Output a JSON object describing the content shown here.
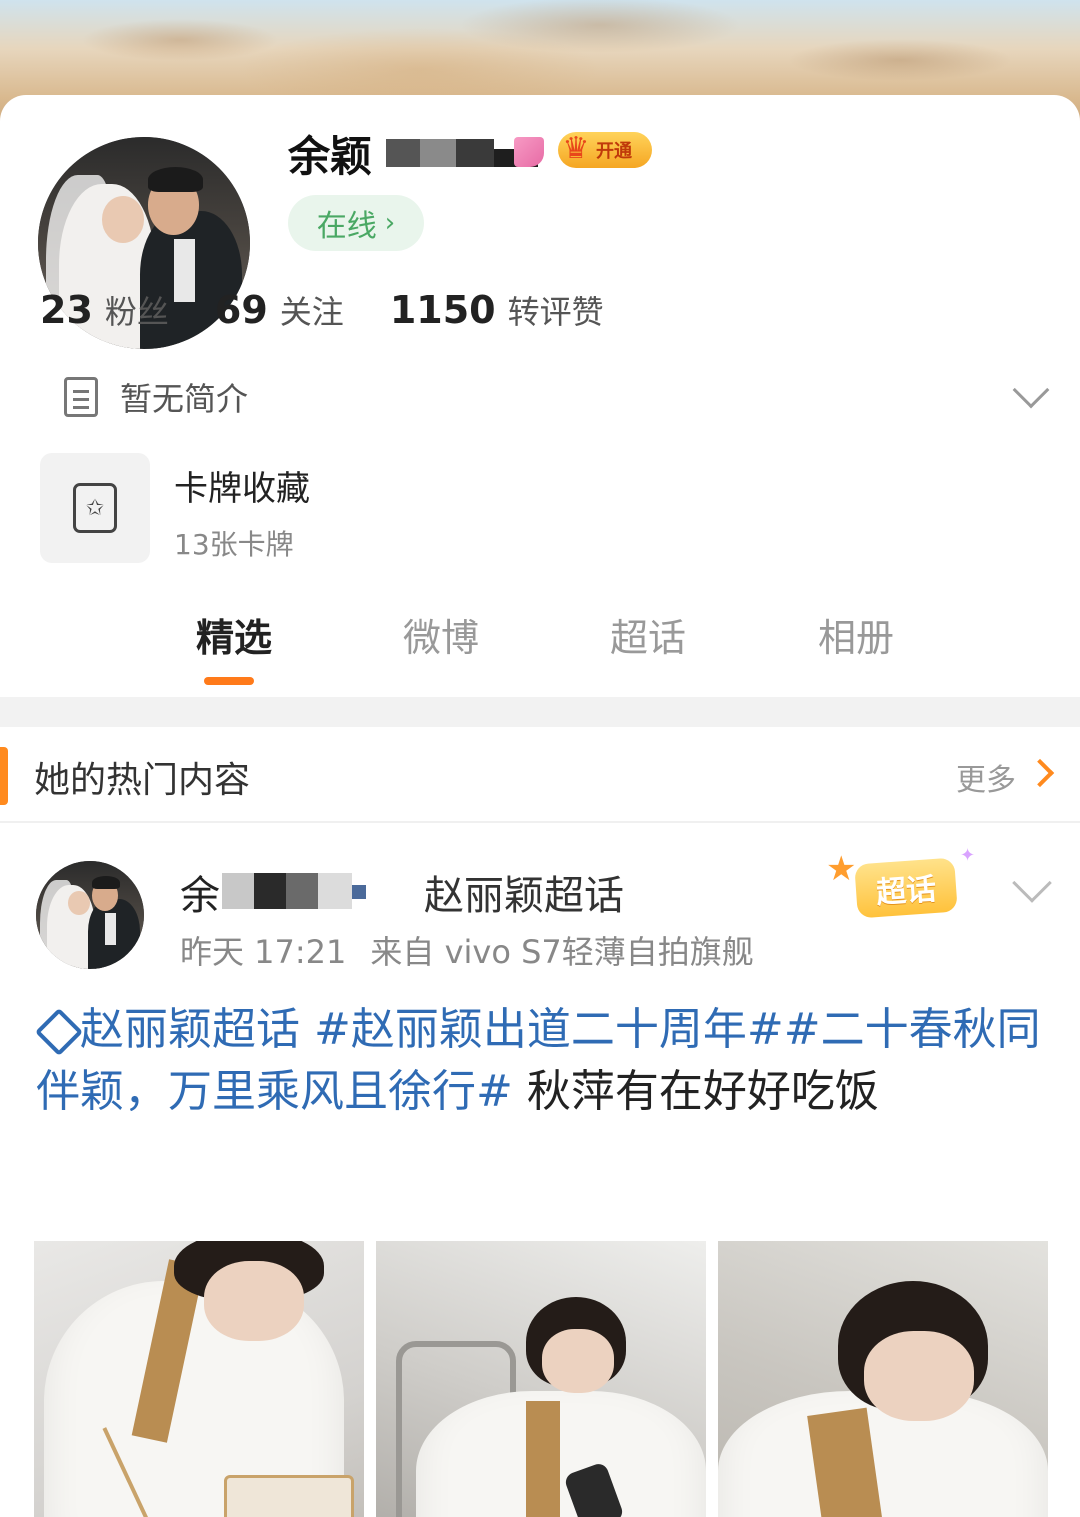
{
  "profile": {
    "name": "余颖",
    "vip_badge": "开通",
    "online_status": "在线",
    "online_chevron": "›",
    "stats": [
      {
        "value": "23",
        "label": "粉丝"
      },
      {
        "value": "69",
        "label": "关注"
      },
      {
        "value": "1150",
        "label": "转评赞"
      }
    ],
    "intro": "暂无简介"
  },
  "card_collection": {
    "title": "卡牌收藏",
    "subtitle": "13张卡牌"
  },
  "tabs": [
    {
      "label": "精选",
      "active": true
    },
    {
      "label": "微博",
      "active": false
    },
    {
      "label": "超话",
      "active": false
    },
    {
      "label": "相册",
      "active": false
    }
  ],
  "hot_section": {
    "title": "她的热门内容",
    "more": "更多"
  },
  "post": {
    "author": "余",
    "topic": "赵丽颖超话",
    "time": "昨天 17:21",
    "source": "来自 vivo S7轻薄自拍旗舰",
    "badge": "超话",
    "text_link1": "赵丽颖超话",
    "text_link2": " #赵丽颖出道二十周年##二十春秋同伴颖，万里乘风且徐行#",
    "text_plain": " 秋萍有在好好吃饭"
  },
  "colors": {
    "accent": "#ff7a1a",
    "link": "#2f6bb4",
    "online_green": "#4aa864"
  },
  "icons": {
    "intro": "document-icon",
    "card": "card-icon",
    "topic": "diamond-icon"
  }
}
